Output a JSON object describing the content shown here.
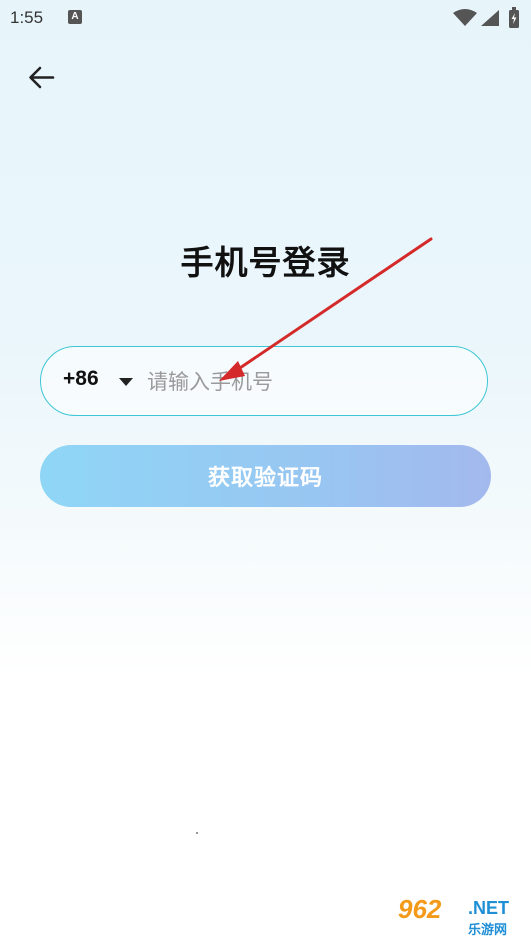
{
  "status_bar": {
    "time": "1:55",
    "notification_letter": "A"
  },
  "login": {
    "title": "手机号登录",
    "country_code": "+86",
    "phone_placeholder": "请输入手机号",
    "phone_value": "",
    "get_code_label": "获取验证码"
  },
  "watermark": {
    "brand_number": "962",
    "brand_suffix": ".NET",
    "site_name": "乐游网"
  },
  "colors": {
    "field_border": "#3ec6d6",
    "button_gradient_start": "#8fd6f6",
    "button_gradient_end": "#a3b9ee",
    "annotation_arrow": "#d42a2a"
  },
  "icons": [
    "back-arrow-icon",
    "dropdown-icon",
    "wifi-icon",
    "signal-icon",
    "battery-icon"
  ]
}
